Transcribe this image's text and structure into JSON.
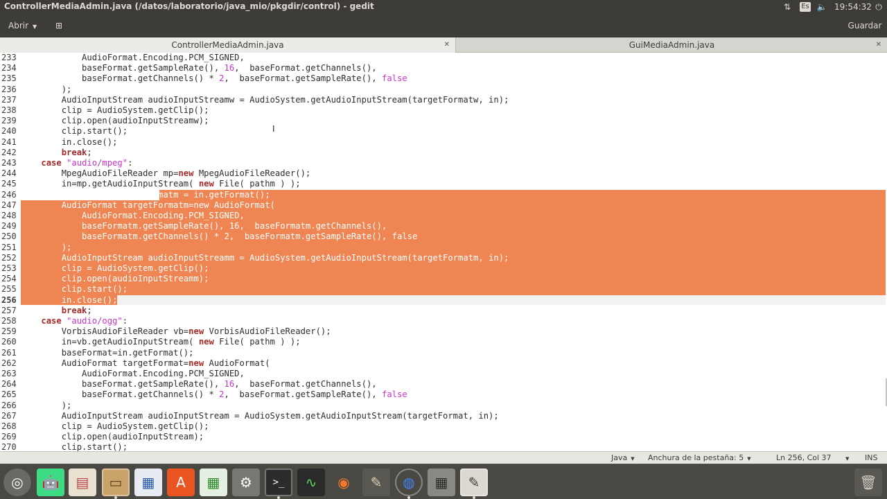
{
  "window": {
    "title": "ControllerMediaAdmin.java (/datos/laboratorio/java_mio/pkgdir/control) - gedit"
  },
  "system_tray": {
    "keyboard_layout": "Es",
    "clock": "19:54:32"
  },
  "headerbar": {
    "open_label": "Abrir",
    "save_label": "Guardar"
  },
  "tabs": [
    {
      "label": "ControllerMediaAdmin.java",
      "active": true
    },
    {
      "label": "GuiMediaAdmin.java",
      "active": false
    }
  ],
  "editor": {
    "line_numbers": [
      "233",
      "234",
      "235",
      "236",
      "237",
      "238",
      "239",
      "240",
      "241",
      "242",
      "243",
      "244",
      "245",
      "246",
      "247",
      "248",
      "249",
      "250",
      "251",
      "252",
      "253",
      "254",
      "255",
      "256",
      "257",
      "258",
      "259",
      "260",
      "261",
      "262",
      "263",
      "264",
      "265",
      "266",
      "267",
      "268",
      "269",
      "270"
    ],
    "current_line": "256"
  },
  "statusbar": {
    "language": "Java",
    "tab_width": "Anchura de la pestaña: 5",
    "position": "Ln 256, Col 37",
    "mode": "INS"
  },
  "dock": {
    "apps": [
      "ubuntu-dash-icon",
      "android-studio-icon",
      "document-viewer-icon",
      "archive-manager-icon",
      "libreoffice-writer-icon",
      "software-center-icon",
      "libreoffice-calc-icon",
      "system-settings-icon",
      "terminal-icon",
      "system-monitor-icon",
      "blender-icon",
      "gimp-icon",
      "chrome-icon",
      "calculator-icon",
      "gedit-icon"
    ],
    "trash": "trash-icon"
  },
  "colors": {
    "selection": "#ef8552",
    "keyword": "#a52a2a",
    "string": "#c833c8",
    "panel": "#3c3b37"
  }
}
